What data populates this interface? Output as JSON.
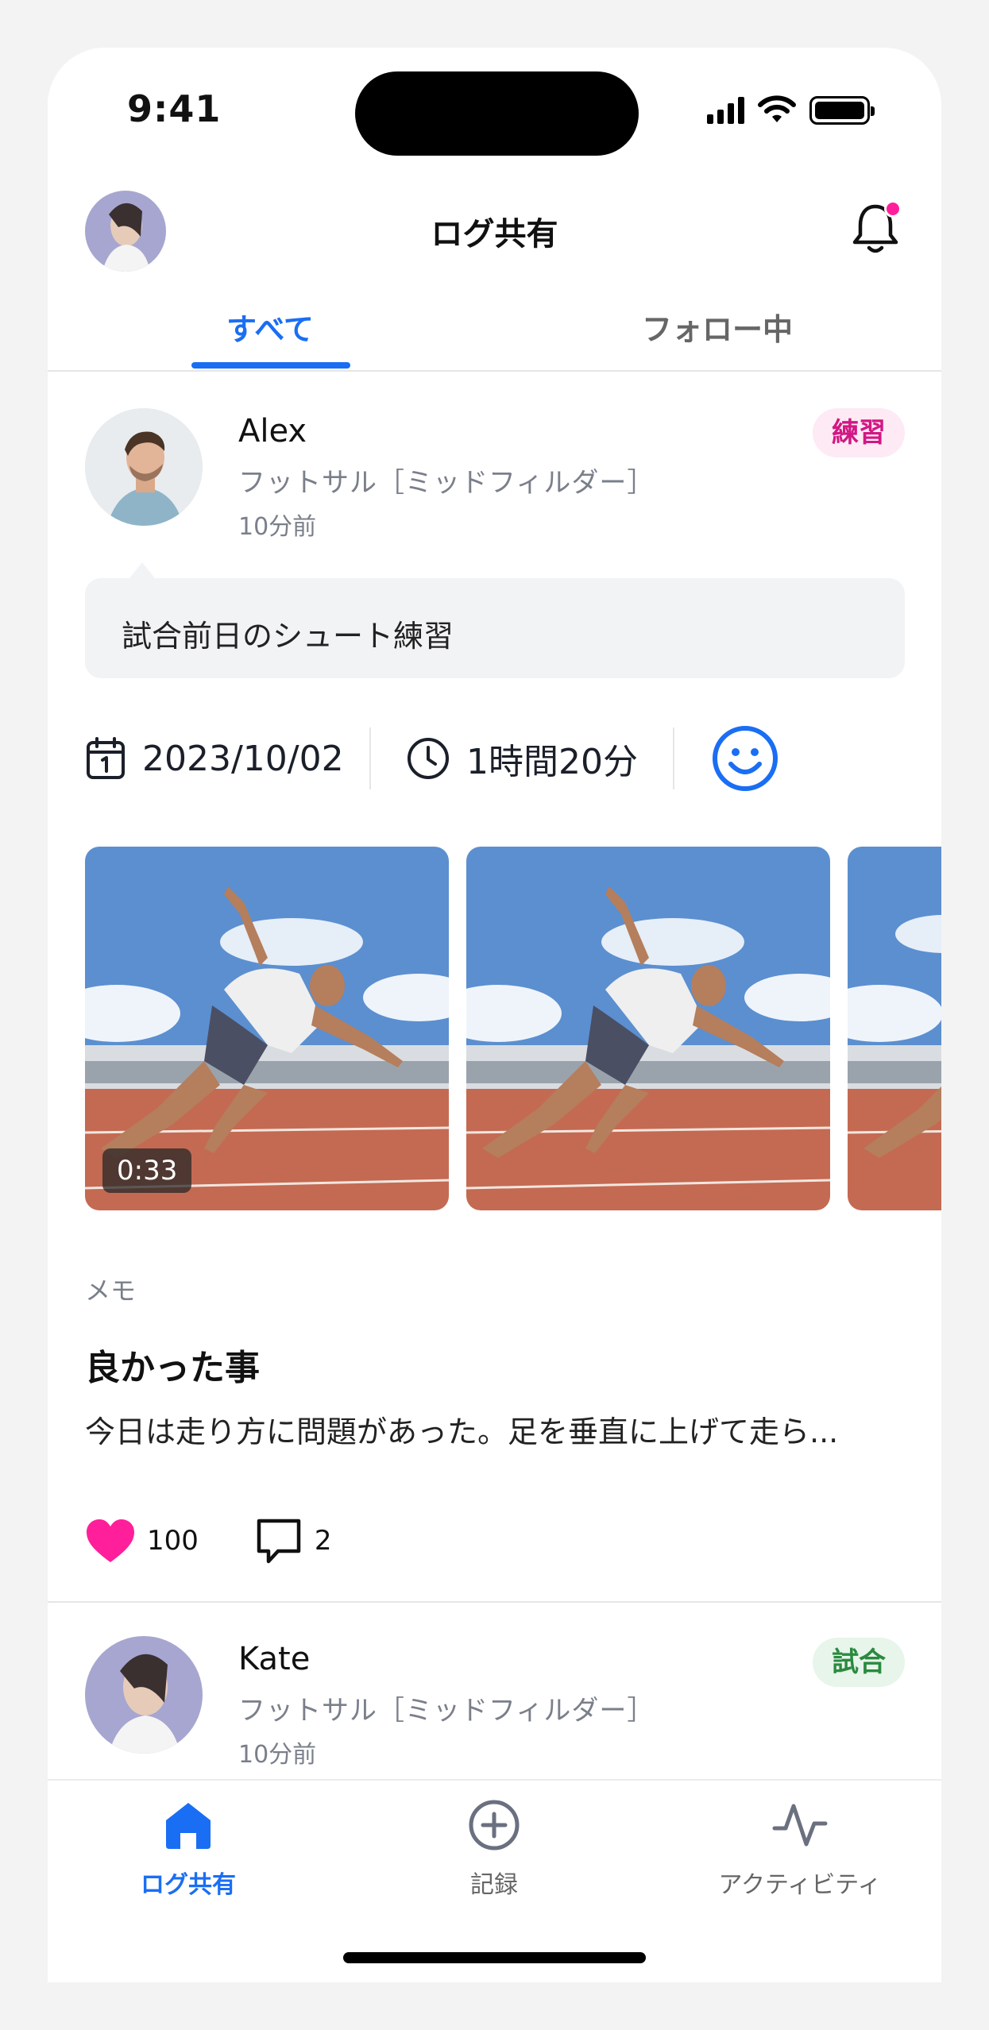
{
  "status": {
    "time": "9:41"
  },
  "header": {
    "title": "ログ共有"
  },
  "tabs": [
    {
      "label": "すべて",
      "active": true
    },
    {
      "label": "フォロー中",
      "active": false
    }
  ],
  "posts": [
    {
      "user": "Alex",
      "sport": "フットサル［ミッドフィルダー］",
      "time": "10分前",
      "badge": "練習",
      "caption": "試合前日のシュート練習",
      "date": "2023/10/02",
      "duration": "1時間20分",
      "photo_duration": "0:33",
      "memo_label": "メモ",
      "memo_title": "良かった事",
      "memo_body": "今日は走り方に問題があった。足を垂直に上げて走ら...",
      "likes": "100",
      "comments": "2"
    },
    {
      "user": "Kate",
      "sport": "フットサル［ミッドフィルダー］",
      "time": "10分前",
      "badge": "試合"
    }
  ],
  "nav": [
    {
      "label": "ログ共有",
      "icon": "home-icon",
      "active": true
    },
    {
      "label": "記録",
      "icon": "plus-circle-icon",
      "active": false
    },
    {
      "label": "アクティビティ",
      "icon": "activity-icon",
      "active": false
    }
  ],
  "colors": {
    "accent": "#1a6ef3",
    "like": "#ff1f9a",
    "practice": "#d21784",
    "match": "#2a8a3f"
  }
}
